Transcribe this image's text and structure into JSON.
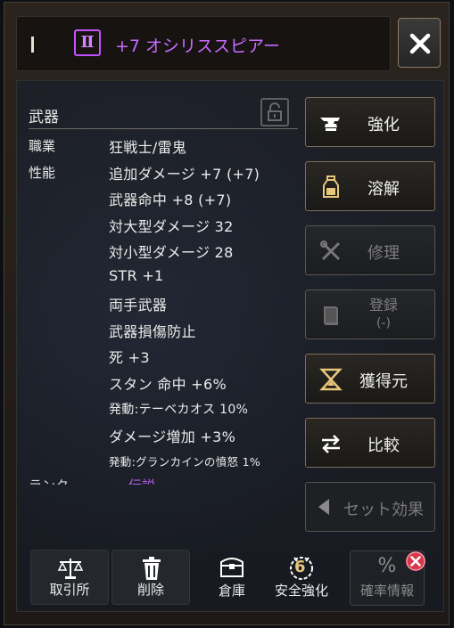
{
  "header": {
    "tier": "Ⅱ",
    "title": "+7  オシリススピアー"
  },
  "item": {
    "category": "武器",
    "class_label": "職業",
    "class_value": "狂戦士/雷鬼",
    "stats_label": "性能",
    "stats": [
      "追加ダメージ +7 (+7)",
      "武器命中 +8 (+7)",
      "対大型ダメージ 32",
      "対小型ダメージ 28",
      "STR +1",
      "両手武器",
      "武器損傷防止",
      "死 +3",
      "スタン 命中 +6%",
      "発動:テーベカオス 10%",
      "ダメージ増加 +3%",
      "発動:グランカインの憤怒 1%"
    ],
    "cut_row_label": "ランク",
    "cut_row_value": "伝説"
  },
  "actions": {
    "enhance": "強化",
    "dissolve": "溶解",
    "repair": "修理",
    "register": "登録",
    "register_sub": "(-)",
    "source": "獲得元",
    "compare": "比較",
    "set_effect": "セット効果"
  },
  "toolbar": {
    "exchange": "取引所",
    "delete": "削除",
    "warehouse": "倉庫",
    "safe_enhance": "安全強化",
    "safe_enhance_badge": "6",
    "probability_symbol": "%",
    "probability": "確率情報"
  },
  "colors": {
    "title_purple": "#c86bff",
    "gold_icon": "#e9c77b",
    "close_red": "#d7374a"
  }
}
